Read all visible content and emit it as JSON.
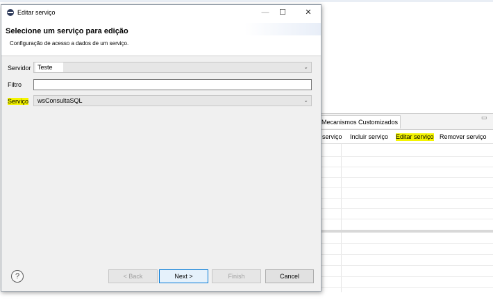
{
  "background": {
    "panel_tab": "Mecanismos Customizados",
    "toolbar": [
      "s serviço",
      "Incluir serviço",
      "Editar serviço",
      "Remover serviço"
    ],
    "minimize_glyph": "▭"
  },
  "dialog": {
    "title": "Editar serviço",
    "window_controls": {
      "minimize": "—",
      "maximize": "☐",
      "close": "✕"
    },
    "header_title": "Selecione um serviço para edição",
    "header_subtitle": "Configuração de acesso a dados de um serviço.",
    "fields": {
      "servidor_label": "Servidor",
      "servidor_value": "Teste",
      "filtro_label": "Filtro",
      "filtro_value": "",
      "servico_label": "Serviço",
      "servico_value": "wsConsultaSQL"
    },
    "buttons": {
      "help": "?",
      "back": "< Back",
      "next": "Next >",
      "finish": "Finish",
      "cancel": "Cancel"
    }
  },
  "colors": {
    "highlight": "#f4f400",
    "default_button_border": "#0078d7"
  }
}
